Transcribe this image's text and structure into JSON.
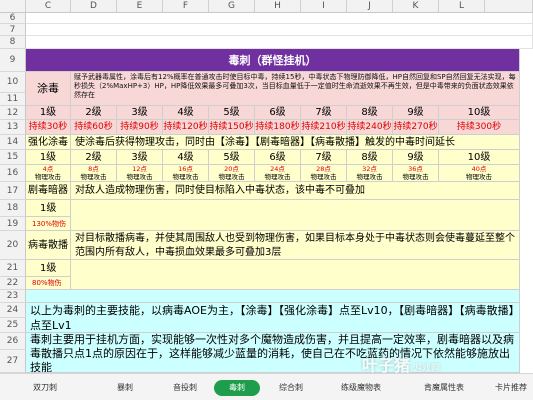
{
  "column_headers": [
    "C",
    "D",
    "E",
    "F",
    "G",
    "H",
    "I",
    "J",
    "K",
    "L"
  ],
  "row_numbers": [
    "6",
    "7",
    "8",
    "9",
    "10",
    "11",
    "12",
    "13",
    "14",
    "15",
    "16",
    "17",
    "18",
    "19",
    "20",
    "21",
    "22",
    "23",
    "24",
    "25",
    "26",
    "27"
  ],
  "title": "毒刺（群怪挂机）",
  "r10": {
    "name": "涂毒",
    "desc": "赋予武器毒属性，涂毒后有12%概率在普通攻击时使目标中毒，持续15秒，中毒状态下物理防御降低，HP自然回复和SP自然回复无法实现，每秒损失（2%MaxHP+3）HP，HP降低效果最多可叠加3次，当目标血量低于一定值时生命流逝效果不再生效，但是中毒带来的负面状态效果依然存在"
  },
  "r12": {
    "levels": [
      "1级",
      "2级",
      "3级",
      "4级",
      "5级",
      "6级",
      "7级",
      "8级",
      "9级",
      "10级"
    ],
    "durations": [
      "持续30秒",
      "持续60秒",
      "持续90秒",
      "持续120秒",
      "持续150秒",
      "持续180秒",
      "持续210秒",
      "持续240秒",
      "持续270秒",
      "持续300秒"
    ]
  },
  "r14": {
    "name": "强化涂毒",
    "desc": "使涂毒后获得物理攻击，同时由【涂毒】【剧毒暗器】【病毒散播】触发的中毒时间延长"
  },
  "r15": {
    "levels": [
      "1级",
      "2级",
      "3级",
      "4级",
      "5级",
      "6级",
      "7级",
      "8级",
      "9级",
      "10级"
    ],
    "points": [
      "4点",
      "8点",
      "12点",
      "16点",
      "20点",
      "24点",
      "28点",
      "32点",
      "36点",
      "40点"
    ],
    "stat": "物理攻击"
  },
  "r17": {
    "name": "剧毒暗器",
    "desc": "对敌人造成物理伤害，同时使目标陷入中毒状态，该中毒不可叠加",
    "level": "1级",
    "pct": "130%物伤"
  },
  "r20": {
    "name": "病毒散播",
    "desc": "对目标散播病毒，并使其周围敌人也受到物理伤害，如果目标本身处于中毒状态则会使毒蔓延至整个范围内所有敌人，中毒损血效果最多可叠加3层",
    "level": "1级",
    "pct": "80%物伤"
  },
  "r23": {
    "summary1": "以上为毒刺的主要技能，以病毒AOE为主，【涂毒】【强化涂毒】点至Lv10，【剧毒暗器】【病毒散播】点至Lv1",
    "summary2": "毒刺主要用于挂机方面，实现能够一次性对多个魔物造成伤害，并且提高一定效率，剧毒暗器以及病毒散播只点1点的原因在于，这样能够减少蓝量的消耗，使自己在不吃蓝药的情况下依然能够施放出技能"
  },
  "tabs": [
    "双刀刺",
    "暴刺",
    "音投刺",
    "毒刺",
    "综合刺",
    "练级魔物表",
    "肯魔属性表",
    "卡片推荐"
  ],
  "active_tab": "毒刺",
  "watermark": {
    "main": "叶子猪",
    "sub": "游戏网"
  },
  "colors": {
    "title": "#7030a0",
    "pink": "#f8d7d7",
    "yellow": "#ffffcc",
    "cyan": "#ccffff",
    "red": "#e00000",
    "active_tab": "#1e9d4c"
  }
}
